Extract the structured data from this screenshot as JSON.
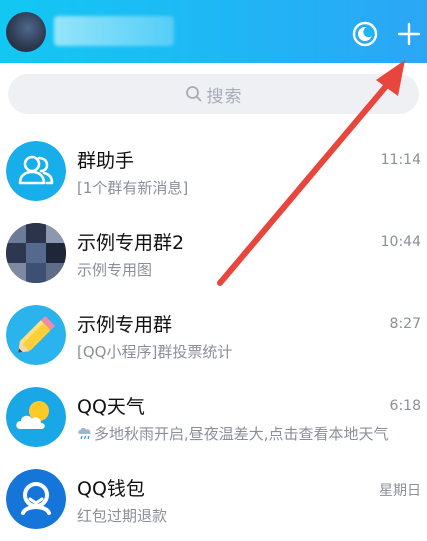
{
  "header": {
    "avatar": "user-avatar",
    "nickname": "",
    "icons": [
      "moon-icon",
      "plus-icon"
    ]
  },
  "search": {
    "placeholder": "搜索",
    "icon": "search-icon"
  },
  "conversations": [
    {
      "title": "群助手",
      "subtitle": "[1个群有新消息]",
      "time": "11:14",
      "icon": "group-assistant-icon"
    },
    {
      "title": "示例专用群2",
      "subtitle": "示例专用图",
      "time": "10:44",
      "icon": "group-avatar"
    },
    {
      "title": "示例专用群",
      "subtitle": "[QQ小程序]群投票统计",
      "time": "8:27",
      "icon": "pencil-icon"
    },
    {
      "title": "QQ天气",
      "subtitle": "多地秋雨开启,昼夜温差大,点击查看本地天气",
      "time": "6:18",
      "icon": "weather-icon"
    },
    {
      "title": "QQ钱包",
      "subtitle": "红包过期退款",
      "time": "星期日",
      "icon": "wallet-icon"
    }
  ],
  "colors": {
    "header": "#21b4f5",
    "accent_blue": "#16a8f2",
    "arrow": "#e8453c"
  }
}
